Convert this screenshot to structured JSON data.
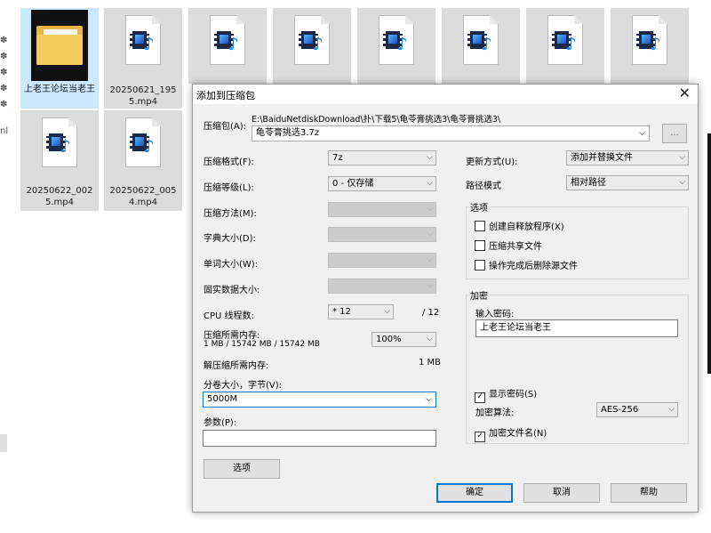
{
  "explorer": {
    "side_glyphs": [
      "✽",
      "✽",
      "✽",
      "✽",
      "✽",
      "nl"
    ],
    "files": [
      {
        "name": "上老王论坛当老王",
        "type": "folder"
      },
      {
        "name": "20250621_1955.mp4",
        "type": "video"
      },
      {
        "name": "",
        "type": "video"
      },
      {
        "name": "",
        "type": "video"
      },
      {
        "name": "",
        "type": "video"
      },
      {
        "name": "",
        "type": "video"
      },
      {
        "name": "",
        "type": "video"
      },
      {
        "name": "",
        "type": "video"
      },
      {
        "name": "20250622_0025.mp4",
        "type": "video"
      },
      {
        "name": "20250622_0054.mp4",
        "type": "video"
      }
    ]
  },
  "dialog": {
    "title": "添加到压缩包",
    "close": "✕",
    "archive_label": "压缩包(A):",
    "archive_path": "E:\\BaiduNetdiskDownload\\扑\\下载5\\龟苓膏挑选3\\龟苓膏挑选3\\",
    "archive_name": "龟苓膏挑选3.7z",
    "browse_label": "...",
    "left": {
      "format_label": "压缩格式(F):",
      "format_value": "7z",
      "level_label": "压缩等级(L):",
      "level_value": "0 - 仅存储",
      "method_label": "压缩方法(M):",
      "dict_label": "字典大小(D):",
      "word_label": "单词大小(W):",
      "solid_label": "固实数据大小:",
      "cpu_label": "CPU 线程数:",
      "cpu_value": "* 12",
      "cpu_total": "/ 12",
      "mem_label": "压缩所需内存:",
      "mem_detail": "1 MB / 15742 MB / 15742 MB",
      "mem_percent": "100%",
      "decomp_label": "解压缩所需内存:",
      "decomp_value": "1 MB",
      "split_label": "分卷大小，字节(V):",
      "split_value": "5000M",
      "params_label": "参数(P):",
      "params_value": "",
      "options_button": "选项"
    },
    "right": {
      "update_label": "更新方式(U):",
      "update_value": "添加并替换文件",
      "path_label": "路径模式",
      "path_value": "相对路径",
      "options_group": "选项",
      "opt_sfx": "创建自释放程序(X)",
      "opt_shared": "压缩共享文件",
      "opt_delete": "操作完成后删除源文件",
      "enc_group": "加密",
      "pwd_label": "输入密码:",
      "pwd_value": "上老王论坛当老王",
      "show_pwd": "显示密码(S)",
      "show_pwd_checked": "✓",
      "enc_method_label": "加密算法:",
      "enc_method_value": "AES-256",
      "enc_names": "加密文件名(N)",
      "enc_names_checked": "✓"
    },
    "buttons": {
      "ok": "确定",
      "cancel": "取消",
      "help": "帮助"
    },
    "dropdown_arrow": "⌵"
  },
  "colors": {
    "accent": "#0078d7",
    "dialog_bg": "#f0f0f0",
    "selection": "#cce8ff"
  }
}
